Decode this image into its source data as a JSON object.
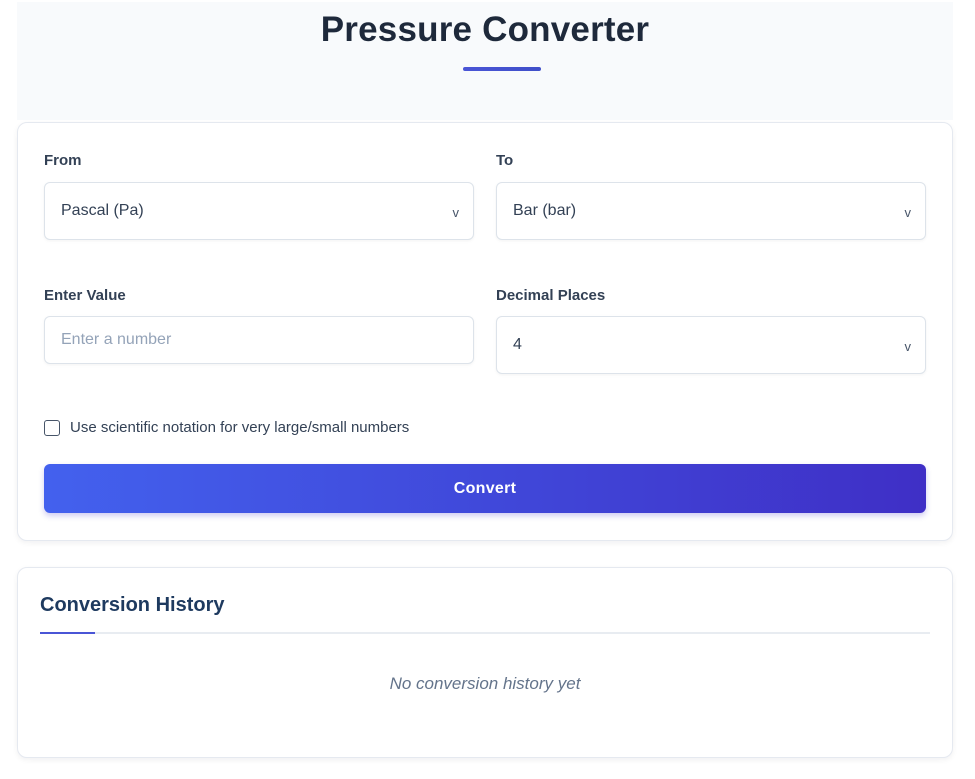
{
  "page": {
    "title": "Pressure Converter"
  },
  "converter": {
    "from_label": "From",
    "from_value": "Pascal (Pa)",
    "to_label": "To",
    "to_value": "Bar (bar)",
    "value_label": "Enter Value",
    "value_input": "",
    "value_placeholder": "Enter a number",
    "decimals_label": "Decimal Places",
    "decimals_value": "4",
    "dropdown_glyph": "v",
    "scientific_label": "Use scientific notation for very large/small numbers",
    "scientific_checked": false,
    "convert_label": "Convert"
  },
  "history": {
    "title": "Conversion History",
    "empty_message": "No conversion history yet"
  },
  "colors": {
    "accent": "#4a55d6",
    "button_start": "#4361ee",
    "button_end": "#3f2fc6",
    "title_text": "#1e293b"
  }
}
